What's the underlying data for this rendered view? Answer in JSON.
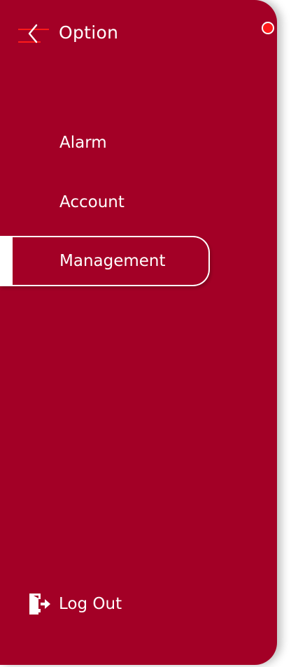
{
  "header": {
    "title": "Option",
    "back_icon": "back-arrow-icon"
  },
  "menu": {
    "items": [
      {
        "label": "Alarm",
        "active": false
      },
      {
        "label": "Account",
        "active": false
      },
      {
        "label": "Management",
        "active": true
      }
    ]
  },
  "footer": {
    "logout_label": "Log Out",
    "logout_icon": "logout-door-icon"
  },
  "colors": {
    "drawer_bg": "#a30026",
    "text": "#ffffff",
    "accent_red": "#ff1a1a"
  }
}
